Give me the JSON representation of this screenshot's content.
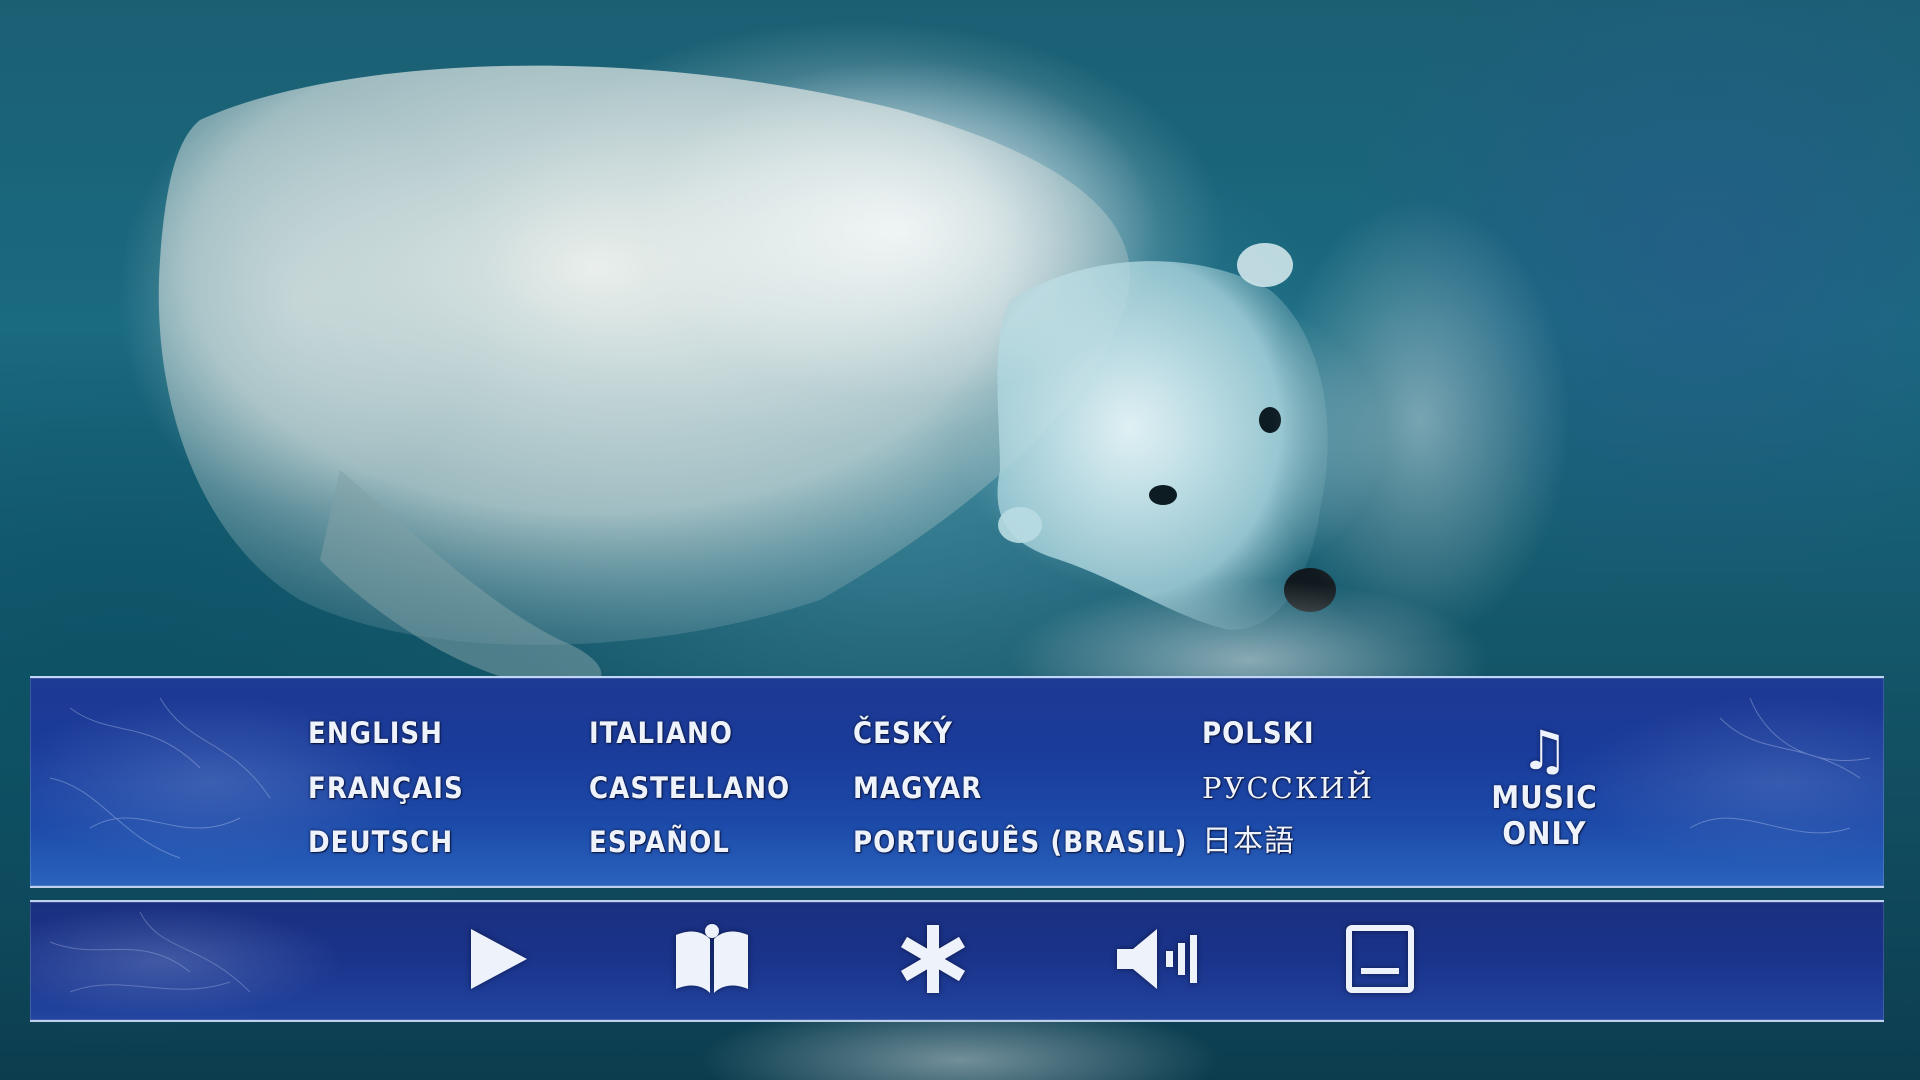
{
  "menu": {
    "languages": [
      {
        "id": "english",
        "label": "ENGLISH"
      },
      {
        "id": "francais",
        "label": "FRANÇAIS"
      },
      {
        "id": "deutsch",
        "label": "DEUTSCH"
      },
      {
        "id": "italiano",
        "label": "ITALIANO"
      },
      {
        "id": "castellano",
        "label": "CASTELLANO"
      },
      {
        "id": "espanol",
        "label": "ESPAÑOL"
      },
      {
        "id": "cesky",
        "label": "ČESKÝ"
      },
      {
        "id": "magyar",
        "label": "MAGYAR"
      },
      {
        "id": "portugues-brasil",
        "label": "PORTUGUÊS (BRASIL)"
      },
      {
        "id": "polski",
        "label": "POLSKI"
      },
      {
        "id": "russkiy",
        "label": "РУССКИЙ"
      },
      {
        "id": "nihongo",
        "label": "日本語"
      }
    ],
    "music_only": {
      "icon": "music-note-icon",
      "glyph": "♫",
      "label": "MUSIC ONLY"
    }
  },
  "icon_bar": {
    "items": [
      {
        "id": "play",
        "icon": "play-icon"
      },
      {
        "id": "chapters",
        "icon": "open-book-icon"
      },
      {
        "id": "extras",
        "icon": "asterisk-icon"
      },
      {
        "id": "audio",
        "icon": "speaker-icon"
      },
      {
        "id": "subtitles",
        "icon": "subtitles-icon"
      }
    ]
  },
  "colors": {
    "panel_blue": "#1c4aa9",
    "text": "#eef2fb",
    "water": "#1a6a80"
  }
}
